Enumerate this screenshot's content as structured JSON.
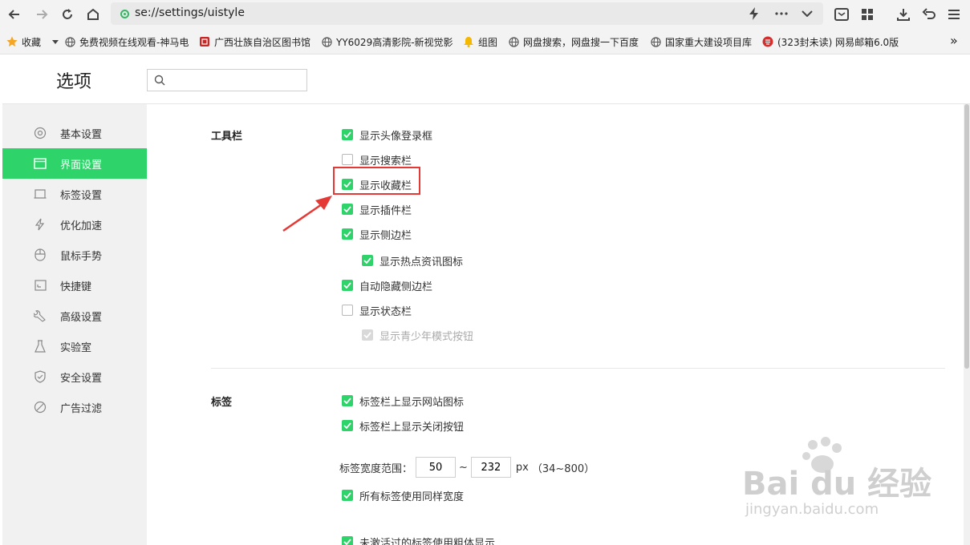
{
  "browser": {
    "url": "se://settings/uistyle"
  },
  "bookmarks": {
    "favorites_label": "收藏",
    "more_label": "»",
    "items": [
      {
        "label": "免费视频在线观看-神马电",
        "icon": "globe-icon"
      },
      {
        "label": "广西壮族自治区图书馆",
        "icon": "library-seal-icon"
      },
      {
        "label": "YY6029高清影院-新视觉影",
        "icon": "globe-icon"
      },
      {
        "label": "组图",
        "icon": "bell-icon"
      },
      {
        "label": "网盘搜索，网盘搜一下百度",
        "icon": "globe-icon"
      },
      {
        "label": "国家重大建设项目库",
        "icon": "globe-icon"
      },
      {
        "label": "(323封未读) 网易邮箱6.0版",
        "icon": "mail-logo-icon"
      }
    ]
  },
  "page": {
    "title": "选项",
    "search_placeholder": ""
  },
  "sidebar": {
    "items": [
      {
        "label": "基本设置",
        "icon": "gear-icon"
      },
      {
        "label": "界面设置",
        "icon": "window-icon",
        "active": true
      },
      {
        "label": "标签设置",
        "icon": "tab-icon"
      },
      {
        "label": "优化加速",
        "icon": "lightning-icon"
      },
      {
        "label": "鼠标手势",
        "icon": "mouse-icon"
      },
      {
        "label": "快捷键",
        "icon": "keyboard-icon"
      },
      {
        "label": "高级设置",
        "icon": "wrench-icon"
      },
      {
        "label": "实验室",
        "icon": "flask-icon"
      },
      {
        "label": "安全设置",
        "icon": "shield-icon"
      },
      {
        "label": "广告过滤",
        "icon": "block-icon"
      }
    ]
  },
  "toolbar_section": {
    "title": "工具栏",
    "options": [
      {
        "label": "显示头像登录框",
        "checked": true
      },
      {
        "label": "显示搜索栏",
        "checked": false
      },
      {
        "label": "显示收藏栏",
        "checked": true
      },
      {
        "label": "显示插件栏",
        "checked": true
      },
      {
        "label": "显示侧边栏",
        "checked": true
      },
      {
        "label": "显示热点资讯图标",
        "checked": true
      },
      {
        "label": "自动隐藏侧边栏",
        "checked": true
      },
      {
        "label": "显示状态栏",
        "checked": false
      },
      {
        "label": "显示青少年模式按钮",
        "checked": true,
        "disabled": true
      }
    ]
  },
  "tabs_section": {
    "title": "标签",
    "options": [
      {
        "label": "标签栏上显示网站图标",
        "checked": true
      },
      {
        "label": "标签栏上显示关闭按钮",
        "checked": true
      },
      {
        "label": "所有标签使用同样宽度",
        "checked": true
      },
      {
        "label": "未激活过的标签使用粗体显示",
        "checked": true
      }
    ],
    "width_range": {
      "label": "标签宽度范围：",
      "min": "50",
      "separator": "~",
      "max": "232",
      "unit": "px",
      "hint": "（34~800）"
    }
  },
  "watermark": {
    "brand": "Bai du 经验",
    "site": "jingyan.baidu.com"
  },
  "colors": {
    "accent": "#2ed36a",
    "highlight": "#e53935"
  }
}
